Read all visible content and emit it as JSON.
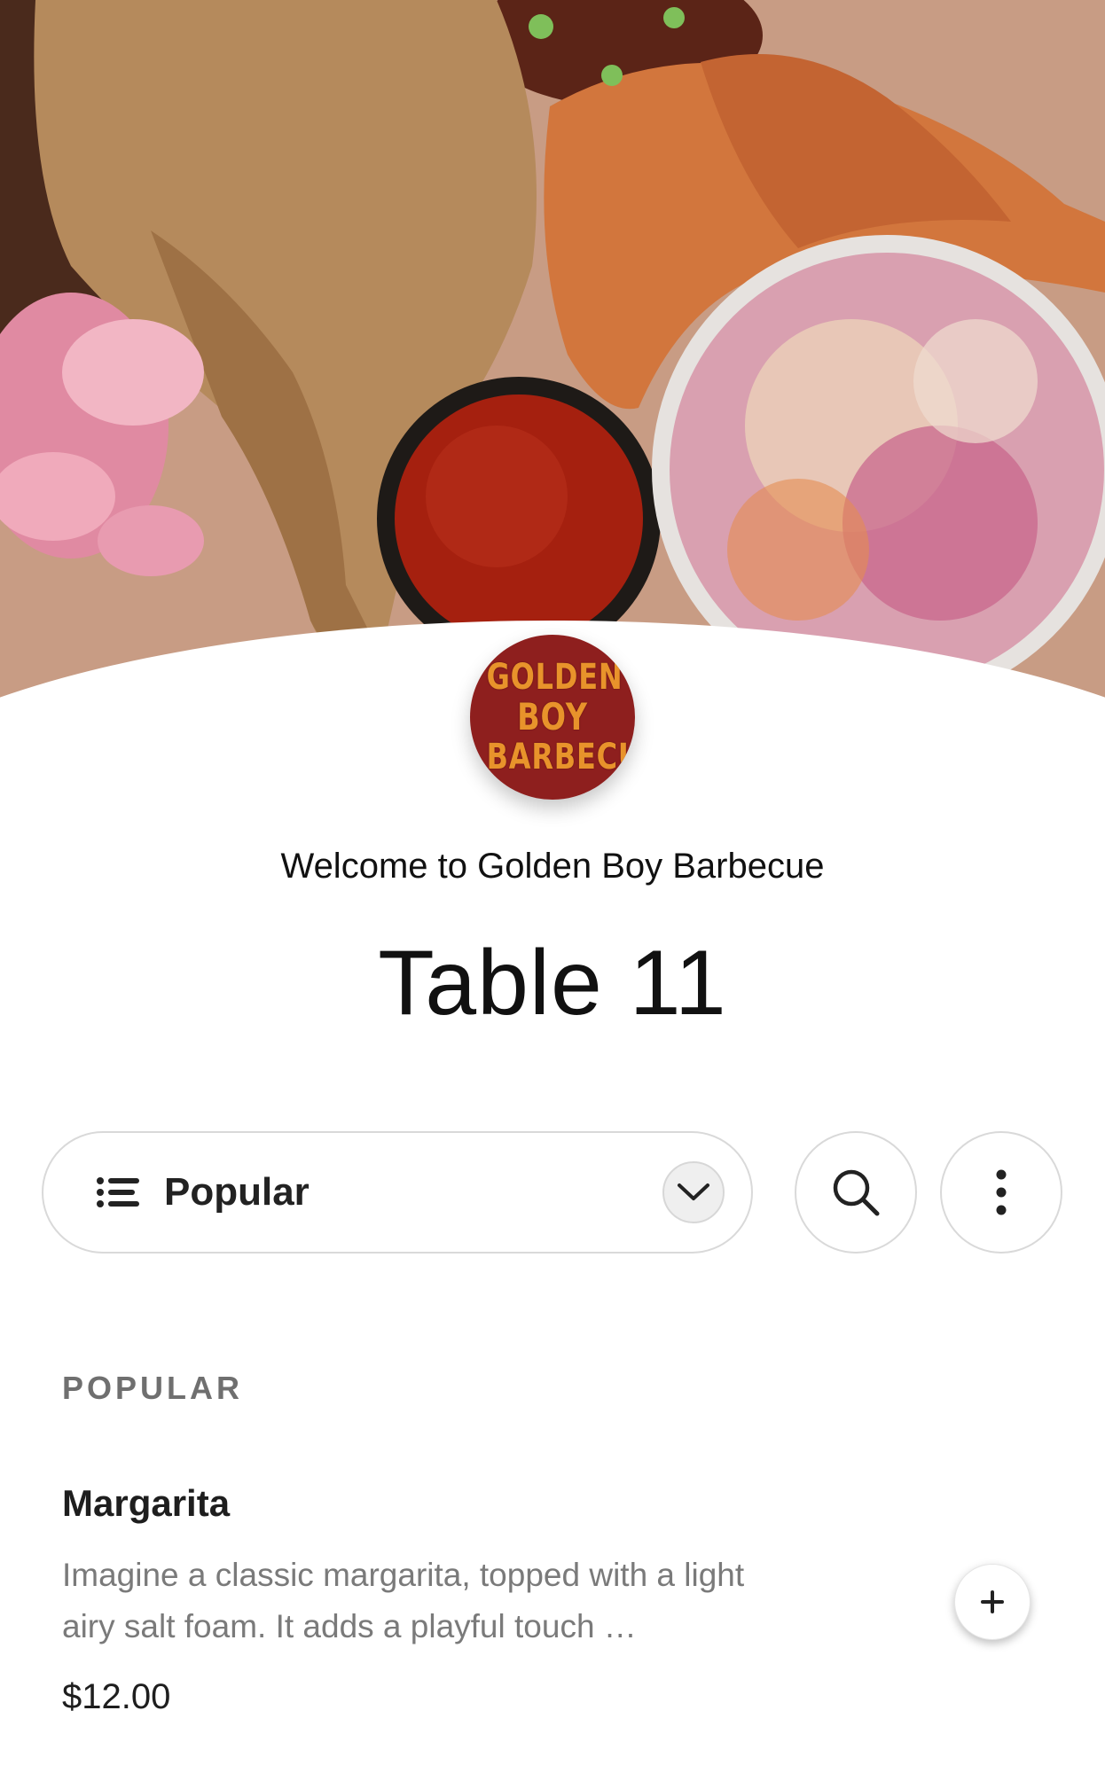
{
  "hero": {
    "alt": "Barbecue platter with roasted chicken, sauce, and coleslaw"
  },
  "restaurant": {
    "welcome": "Welcome to Golden Boy Barbecue",
    "logo_line1": "GOLDEN",
    "logo_line2": "BOY",
    "logo_line3": "BARBECUE"
  },
  "table": {
    "title": "Table 11"
  },
  "toolbar": {
    "category_label": "Popular",
    "list_icon": "list-icon",
    "chevron_icon": "chevron-down-icon",
    "search_icon": "search-icon",
    "more_icon": "more-vertical-icon"
  },
  "menu": {
    "section_title": "POPULAR",
    "items": [
      {
        "name": "Margarita",
        "description": "Imagine a classic margarita, topped with a light airy salt foam. It adds a playful touch …",
        "price": "$12.00"
      }
    ]
  },
  "colors": {
    "logo_bg": "#8e1f1e",
    "logo_text": "#e8932b",
    "border": "#d9d9d9",
    "muted_text": "#7a7a7a"
  }
}
